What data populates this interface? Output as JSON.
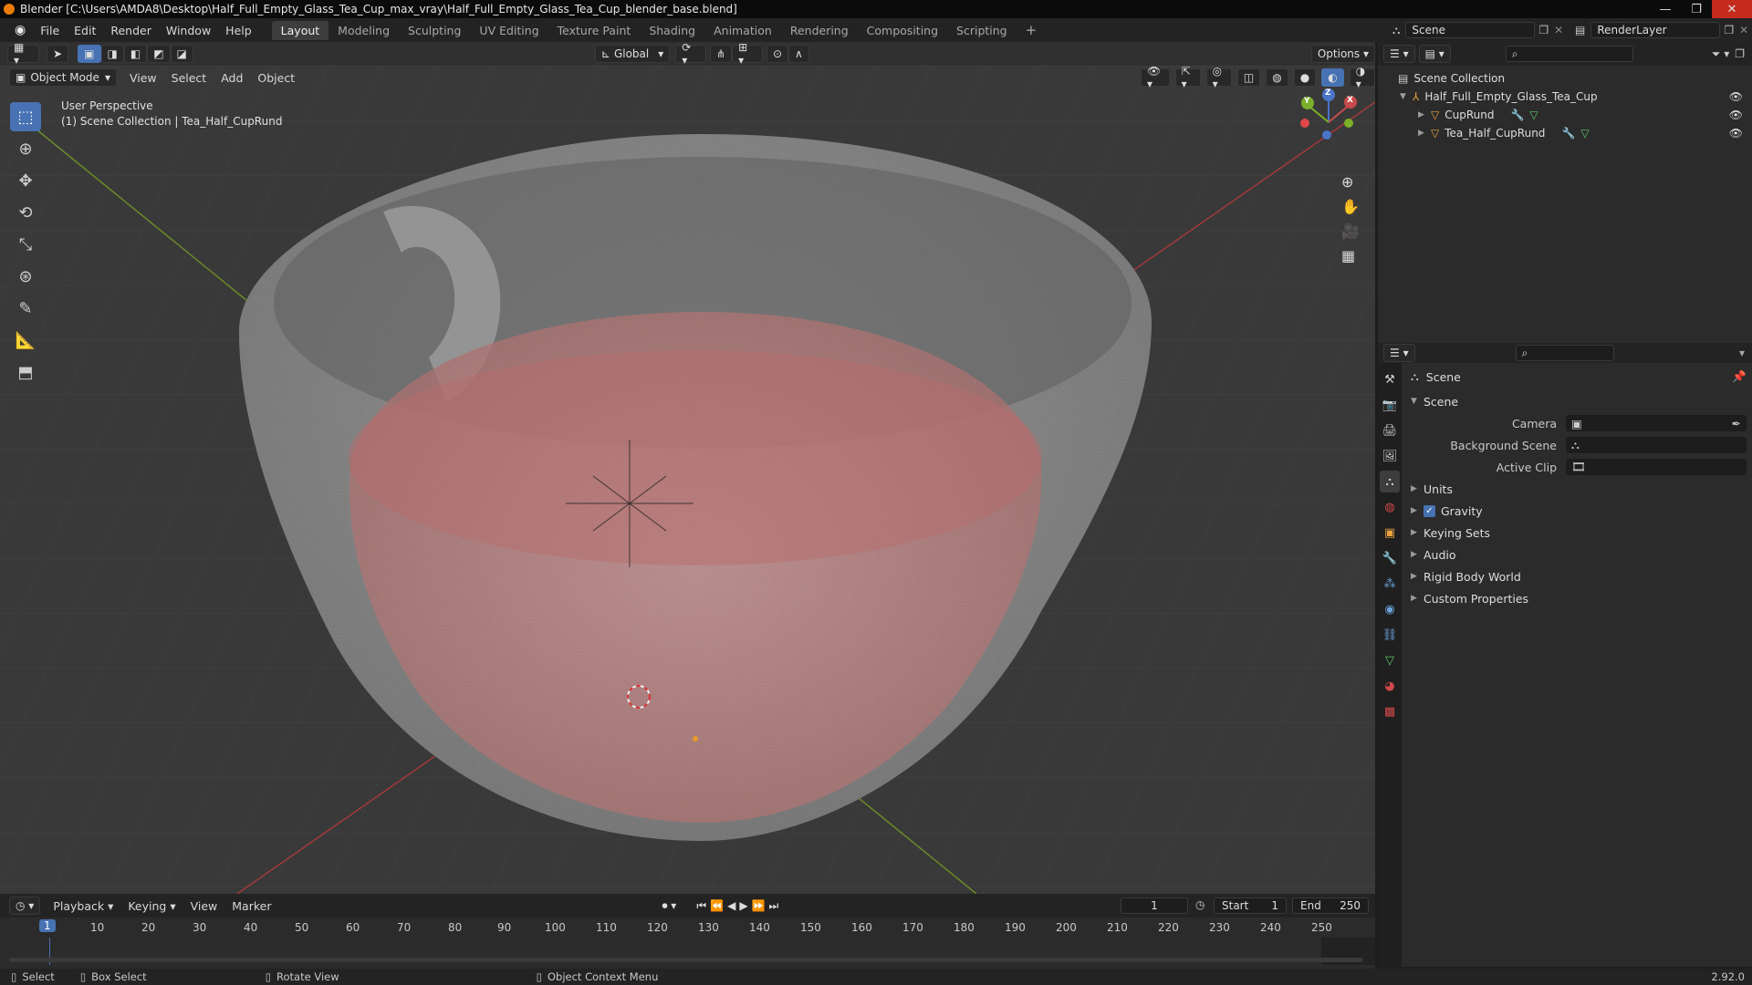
{
  "window": {
    "title": "Blender [C:\\Users\\AMDA8\\Desktop\\Half_Full_Empty_Glass_Tea_Cup_max_vray\\Half_Full_Empty_Glass_Tea_Cup_blender_base.blend]",
    "minimize": "—",
    "restore": "❐",
    "close": "✕"
  },
  "menu": [
    "File",
    "Edit",
    "Render",
    "Window",
    "Help"
  ],
  "workspaces": [
    "Layout",
    "Modeling",
    "Sculpting",
    "UV Editing",
    "Texture Paint",
    "Shading",
    "Animation",
    "Rendering",
    "Compositing",
    "Scripting"
  ],
  "workspace_add": "+",
  "scene_selector": {
    "value": "Scene"
  },
  "renderlayer_selector": {
    "value": "RenderLayer"
  },
  "viewport_header": {
    "transform_orientation": "Global",
    "options": "Options",
    "mode": "Object Mode",
    "menus": [
      "View",
      "Select",
      "Add",
      "Object"
    ]
  },
  "viewport": {
    "perspective_label": "User Perspective",
    "context_label": "(1) Scene Collection | Tea_Half_CupRund",
    "gizmo_axes": {
      "x": "X",
      "y": "Y",
      "z": "Z"
    },
    "colors": {
      "background": "#393939",
      "cup": "#9a9a9a",
      "tea": "#c47a7a",
      "x_axis": "#a23a3a",
      "y_axis": "#6a8a2a"
    }
  },
  "outliner": {
    "root": "Scene Collection",
    "collection": "Half_Full_Empty_Glass_Tea_Cup",
    "objects": [
      "CupRund",
      "Tea_Half_CupRund"
    ]
  },
  "properties": {
    "breadcrumb": "Scene",
    "section": "Scene",
    "fields": [
      {
        "label": "Camera",
        "value": ""
      },
      {
        "label": "Background Scene",
        "value": ""
      },
      {
        "label": "Active Clip",
        "value": ""
      }
    ],
    "panels": [
      {
        "label": "Units",
        "checkbox": false
      },
      {
        "label": "Gravity",
        "checkbox": true
      },
      {
        "label": "Keying Sets",
        "checkbox": false
      },
      {
        "label": "Audio",
        "checkbox": false
      },
      {
        "label": "Rigid Body World",
        "checkbox": false
      },
      {
        "label": "Custom Properties",
        "checkbox": false
      }
    ]
  },
  "timeline": {
    "menus": [
      "Playback",
      "Keying",
      "View",
      "Marker"
    ],
    "current_frame": "1",
    "start_label": "Start",
    "start": "1",
    "end_label": "End",
    "end": "250",
    "ruler": [
      "1",
      "10",
      "20",
      "30",
      "40",
      "50",
      "60",
      "70",
      "80",
      "90",
      "100",
      "110",
      "120",
      "130",
      "140",
      "150",
      "160",
      "170",
      "180",
      "190",
      "200",
      "210",
      "220",
      "230",
      "240",
      "250"
    ]
  },
  "statusbar": {
    "items": [
      "Select",
      "Box Select",
      "Rotate View",
      "Object Context Menu"
    ],
    "version": "2.92.0"
  }
}
